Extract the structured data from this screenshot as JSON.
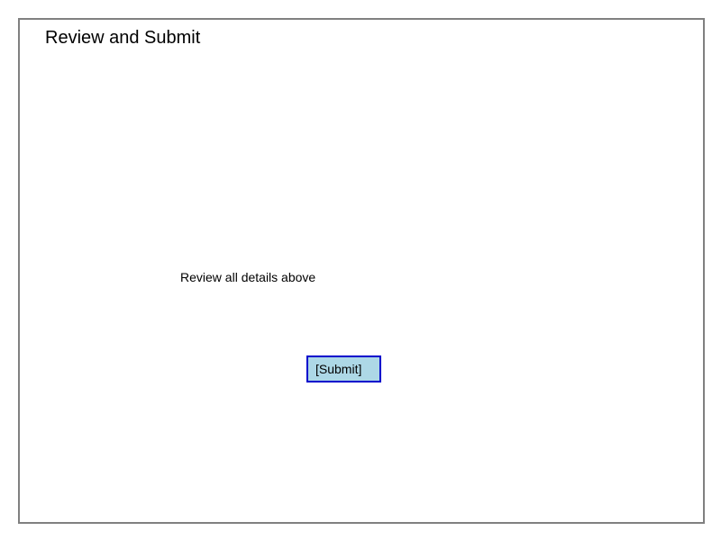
{
  "page": {
    "title": "Review and Submit",
    "instruction": "Review all details above"
  },
  "actions": {
    "submit_label": "[Submit]"
  },
  "colors": {
    "frame_border": "#808080",
    "button_fill": "#add8e6",
    "button_border": "#0000cc"
  }
}
